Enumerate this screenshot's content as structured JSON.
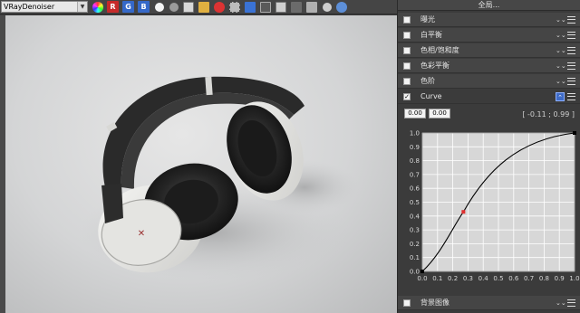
{
  "toolbar": {
    "layer_select": "VRayDenoiser",
    "r_label": "R",
    "g_label": "G",
    "b_label": "B",
    "icons": [
      "color-wheel-icon",
      "white-circle-icon",
      "gray-circle-icon",
      "save-icon",
      "folder-icon",
      "clear-icon",
      "region-icon",
      "cursor-icon",
      "track-icon",
      "compare-icon",
      "lens-icon",
      "stamp-icon",
      "circle-icon",
      "teapot-icon"
    ]
  },
  "panel": {
    "global_label": "全局...",
    "sections": [
      {
        "label": "曝光",
        "checked": false
      },
      {
        "label": "白平衡",
        "checked": false
      },
      {
        "label": "色相/饱和度",
        "checked": false
      },
      {
        "label": "色彩平衡",
        "checked": false
      },
      {
        "label": "色阶",
        "checked": false
      },
      {
        "label": "Curve",
        "checked": true
      },
      {
        "label": "背景图像",
        "checked": false
      }
    ],
    "curve": {
      "input_x": "0.00",
      "input_y": "0.00",
      "readout": "[ -0.11 ; 0.99 ]",
      "x_ticks": [
        "0.0",
        "0.1",
        "0.2",
        "0.3",
        "0.4",
        "0.5",
        "0.6",
        "0.7",
        "0.8",
        "0.9",
        "1.0"
      ],
      "y_ticks": [
        "1.0",
        "0.9",
        "0.8",
        "0.7",
        "0.6",
        "0.5",
        "0.4",
        "0.3",
        "0.2",
        "0.1",
        "0.0"
      ],
      "points": [
        [
          0,
          0
        ],
        [
          0.27,
          0.43
        ],
        [
          1,
          1
        ]
      ],
      "colors": {
        "grid": "#ffffff",
        "line": "#000000",
        "point_red": "#e03030"
      }
    }
  }
}
